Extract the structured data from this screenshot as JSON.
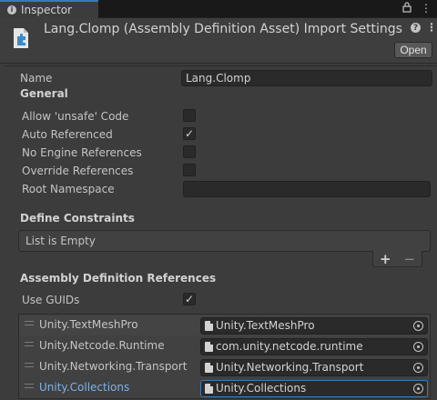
{
  "tab": {
    "title": "Inspector"
  },
  "header": {
    "title": "Lang.Clomp (Assembly Definition Asset) Import Settings",
    "open_label": "Open"
  },
  "fields": {
    "name_label": "Name",
    "name_value": "Lang.Clomp",
    "general_header": "General",
    "allow_unsafe": {
      "label": "Allow 'unsafe' Code",
      "checked": false
    },
    "auto_referenced": {
      "label": "Auto Referenced",
      "checked": true
    },
    "no_engine_refs": {
      "label": "No Engine References",
      "checked": false
    },
    "override_refs": {
      "label": "Override References",
      "checked": false
    },
    "root_namespace": {
      "label": "Root Namespace",
      "value": ""
    }
  },
  "define_constraints": {
    "header": "Define Constraints",
    "empty_text": "List is Empty",
    "add_label": "+",
    "remove_label": "−"
  },
  "references": {
    "header": "Assembly Definition References",
    "use_guids_label": "Use GUIDs",
    "use_guids_checked": true,
    "rows": [
      {
        "name": "Unity.TextMeshPro",
        "asset": "Unity.TextMeshPro"
      },
      {
        "name": "Unity.Netcode.Runtime",
        "asset": "com.unity.netcode.runtime"
      },
      {
        "name": "Unity.Networking.Transport",
        "asset": "Unity.Networking.Transport"
      },
      {
        "name": "Unity.Collections",
        "asset": "Unity.Collections"
      }
    ]
  },
  "colors": {
    "accent": "#3a79bb",
    "active_text": "#7eb2e8",
    "panel_bg": "#3c3c3c"
  }
}
